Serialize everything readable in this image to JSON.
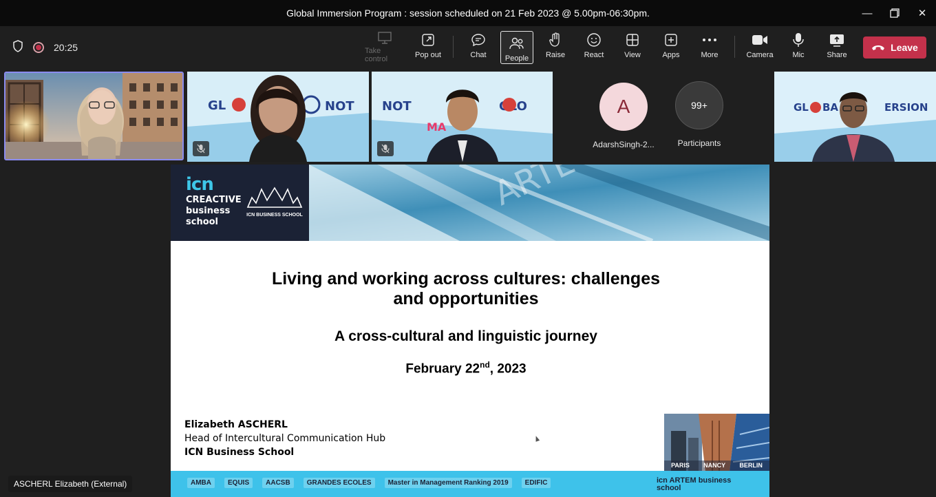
{
  "window": {
    "title": "Global Immersion Program : session scheduled on 21 Feb 2023 @ 5.00pm-06:30pm."
  },
  "toolbar": {
    "timer": "20:25",
    "buttons": {
      "take_control": "Take control",
      "pop_out": "Pop out",
      "chat": "Chat",
      "people": "People",
      "raise": "Raise",
      "react": "React",
      "view": "View",
      "apps": "Apps",
      "more": "More",
      "camera": "Camera",
      "mic": "Mic",
      "share": "Share"
    },
    "leave_label": "Leave"
  },
  "participants": {
    "avatar_initial": "A",
    "avatar_name": "AdarshSingh-2...",
    "overflow_count": "99+",
    "overflow_label": "Participants"
  },
  "slide": {
    "logo": {
      "icn": "icn",
      "line1": "CREACTIVE",
      "line2": "business",
      "line3": "school",
      "badge": "ICN BUSINESS SCHOOL"
    },
    "title": "Living and working across cultures: challenges and opportunities",
    "subtitle": "A cross-cultural and linguistic journey",
    "date_main": "February 22",
    "date_sup": "nd",
    "date_year": ", 2023",
    "presenter_name": "Elizabeth ASCHERL",
    "presenter_role": "Head of Intercultural Communication Hub",
    "presenter_org": "ICN Business School",
    "cities": [
      "PARIS",
      "NANCY",
      "BERLIN"
    ],
    "footer_logos": [
      "AMBA",
      "EQUIS",
      "AACSB",
      "GRANDES ECOLES",
      "Master in Management Ranking 2019",
      "EDIFIC"
    ],
    "footer_right": "icn ARTEM business school"
  },
  "speaker_name_tag": "ASCHERL Elizabeth (External)",
  "colors": {
    "leave": "#c4314b",
    "titlebar": "#0b0b0b",
    "toolbar": "#1f1f1f",
    "active_speaker_border": "#8b8cf0",
    "footer_band": "#3ec2ea"
  }
}
